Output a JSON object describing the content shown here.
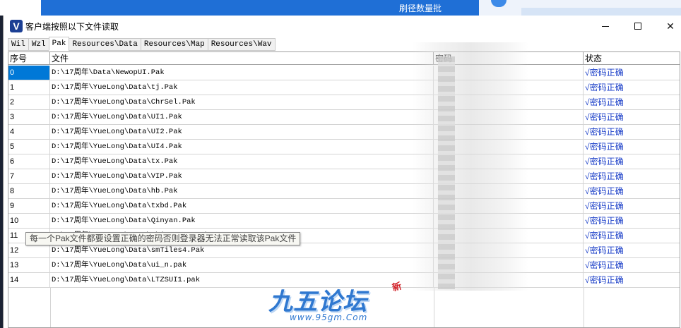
{
  "background": {
    "behind_window_text": "刷径数量批"
  },
  "window": {
    "icon_label": "V",
    "title": "客户端按照以下文件读取"
  },
  "tabs": [
    {
      "label": "Wil",
      "active": false
    },
    {
      "label": "Wzl",
      "active": false
    },
    {
      "label": "Pak",
      "active": true
    },
    {
      "label": "Resources\\Data",
      "active": false
    },
    {
      "label": "Resources\\Map",
      "active": false
    },
    {
      "label": "Resources\\Wav",
      "active": false
    }
  ],
  "grid": {
    "headers": {
      "index": "序号",
      "file": "文件",
      "password": "密码",
      "status": "状态"
    },
    "rows": [
      {
        "index": "0",
        "file": "D:\\17周年\\Data\\NewopUI.Pak",
        "status": "√密码正确"
      },
      {
        "index": "1",
        "file": "D:\\17周年\\YueLong\\Data\\tj.Pak",
        "status": "√密码正确"
      },
      {
        "index": "2",
        "file": "D:\\17周年\\YueLong\\Data\\ChrSel.Pak",
        "status": "√密码正确"
      },
      {
        "index": "3",
        "file": "D:\\17周年\\YueLong\\Data\\UI1.Pak",
        "status": "√密码正确"
      },
      {
        "index": "4",
        "file": "D:\\17周年\\YueLong\\Data\\UI2.Pak",
        "status": "√密码正确"
      },
      {
        "index": "5",
        "file": "D:\\17周年\\YueLong\\Data\\UI4.Pak",
        "status": "√密码正确"
      },
      {
        "index": "6",
        "file": "D:\\17周年\\YueLong\\Data\\tx.Pak",
        "status": "√密码正确"
      },
      {
        "index": "7",
        "file": "D:\\17周年\\YueLong\\Data\\VIP.Pak",
        "status": "√密码正确"
      },
      {
        "index": "8",
        "file": "D:\\17周年\\YueLong\\Data\\hb.Pak",
        "status": "√密码正确"
      },
      {
        "index": "9",
        "file": "D:\\17周年\\YueLong\\Data\\txbd.Pak",
        "status": "√密码正确"
      },
      {
        "index": "10",
        "file": "D:\\17周年\\YueLong\\Data\\Qinyan.Pak",
        "status": "√密码正确"
      },
      {
        "index": "11",
        "file": "D:\\17周年\\YueLong\\Data\\Objects20.Pak",
        "status": "√密码正确"
      },
      {
        "index": "12",
        "file": "D:\\17周年\\YueLong\\Data\\smTiles4.Pak",
        "status": "√密码正确"
      },
      {
        "index": "13",
        "file": "D:\\17周年\\YueLong\\Data\\ui_n.pak",
        "status": "√密码正确"
      },
      {
        "index": "14",
        "file": "D:\\17周年\\YueLong\\Data\\LTZSUI1.pak",
        "status": "√密码正确"
      }
    ]
  },
  "tooltip": {
    "text": "每一个Pak文件都要设置正确的密码否则登录器无法正常读取该Pak文件"
  },
  "watermark": {
    "text": "九五论坛",
    "badge": "新",
    "url": "www.95gm.Com"
  },
  "colors": {
    "status_text": "#1a3ec8",
    "selection": "#0078d7",
    "watermark": "#2f78d0"
  }
}
